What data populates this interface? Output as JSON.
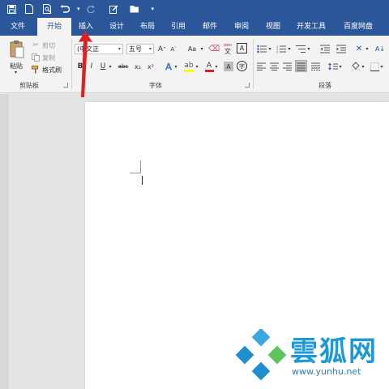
{
  "colors": {
    "ribbon_blue": "#2b579a",
    "annotation_red": "#e02020",
    "watermark_blue": "#1d9ad6"
  },
  "quick_access": {
    "icons": [
      "save-icon",
      "new-document-icon",
      "print-preview-icon",
      "undo-icon",
      "redo-icon",
      "edit-icon",
      "open-folder-icon",
      "customize-icon"
    ]
  },
  "tabs": [
    {
      "label": "文件",
      "active": false
    },
    {
      "label": "开始",
      "active": true
    },
    {
      "label": "插入",
      "active": false
    },
    {
      "label": "设计",
      "active": false
    },
    {
      "label": "布局",
      "active": false
    },
    {
      "label": "引用",
      "active": false
    },
    {
      "label": "邮件",
      "active": false
    },
    {
      "label": "审阅",
      "active": false
    },
    {
      "label": "视图",
      "active": false
    },
    {
      "label": "开发工具",
      "active": false
    },
    {
      "label": "百度网盘",
      "active": false
    }
  ],
  "clipboard": {
    "paste_label": "粘贴",
    "cut_label": "剪切",
    "copy_label": "复制",
    "format_painter_label": "格式刷",
    "group_label": "剪贴板"
  },
  "font": {
    "font_name": "(中文正",
    "font_size": "五号",
    "grow_label": "A",
    "shrink_label": "A",
    "change_case_label": "Aa",
    "phonetic_label": "wén",
    "bold": "B",
    "italic": "I",
    "underline": "U",
    "strikethrough": "abc",
    "subscript": "x₂",
    "superscript": "x²",
    "text_effect": "A",
    "font_color_label": "A",
    "char_shading": "A",
    "enclose_char": "字",
    "group_label": "字体"
  },
  "paragraph": {
    "group_label": "段落"
  }
}
